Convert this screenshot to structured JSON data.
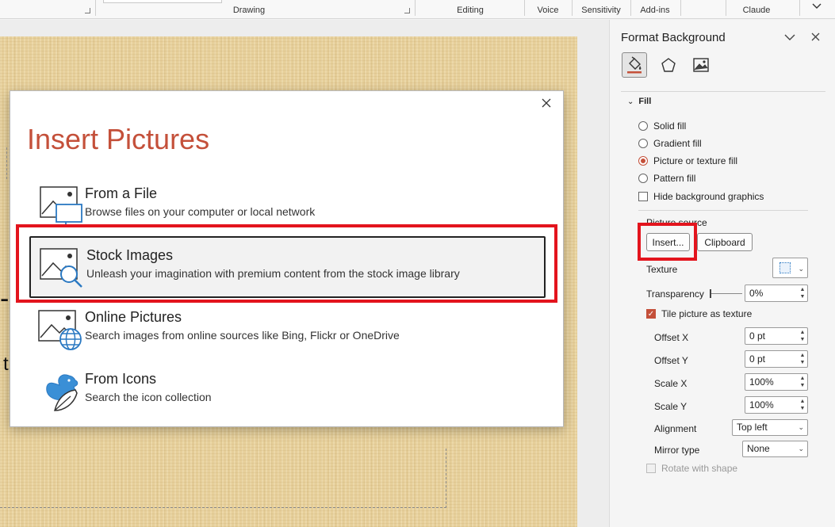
{
  "ribbon": {
    "groups": {
      "drawing": "Drawing",
      "editing": "Editing",
      "voice": "Voice",
      "sensitivity": "Sensitivity",
      "addins": "Add-ins",
      "claude": "Claude"
    }
  },
  "dialog": {
    "title": "Insert Pictures",
    "options": [
      {
        "title": "From a File",
        "desc": "Browse files on your computer or local network",
        "icon": "image-file-icon"
      },
      {
        "title": "Stock Images",
        "desc": "Unleash your imagination with premium content from the stock image library",
        "icon": "image-search-icon"
      },
      {
        "title": "Online Pictures",
        "desc": "Search images from online sources like Bing, Flickr or OneDrive",
        "icon": "image-globe-icon"
      },
      {
        "title": "From Icons",
        "desc": "Search the icon collection",
        "icon": "icons-collection-icon"
      }
    ]
  },
  "pane": {
    "title": "Format Background",
    "section": "Fill",
    "fill_options": {
      "solid": "Solid fill",
      "gradient": "Gradient fill",
      "picture": "Picture or texture fill",
      "pattern": "Pattern fill"
    },
    "hide_bg": "Hide background graphics",
    "picture_source": "Picture source",
    "insert": "Insert...",
    "clipboard": "Clipboard",
    "texture": "Texture",
    "transparency": "Transparency",
    "transparency_value": "0%",
    "tile": "Tile picture as texture",
    "offset_x": "Offset X",
    "offset_x_value": "0 pt",
    "offset_y": "Offset Y",
    "offset_y_value": "0 pt",
    "scale_x": "Scale X",
    "scale_x_value": "100%",
    "scale_y": "Scale Y",
    "scale_y_value": "100%",
    "alignment": "Alignment",
    "alignment_value": "Top left",
    "mirror": "Mirror type",
    "mirror_value": "None",
    "rotate": "Rotate with shape"
  },
  "colors": {
    "accent": "#c4503a",
    "highlight": "#e3141d"
  }
}
